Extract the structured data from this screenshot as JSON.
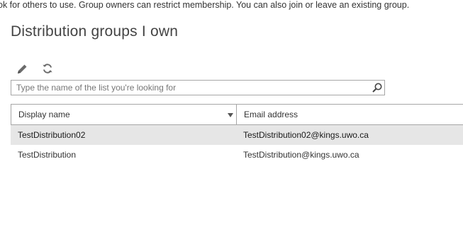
{
  "intro": {
    "text": "ok for others to use. Group owners can restrict membership. You can also join or leave an existing group."
  },
  "section": {
    "title": "Distribution groups I own"
  },
  "toolbar": {
    "edit_icon": "pencil-icon",
    "refresh_icon": "refresh-icon"
  },
  "search": {
    "placeholder": "Type the name of the list you're looking for",
    "value": "",
    "icon": "search-icon"
  },
  "table": {
    "columns": [
      {
        "label": "Display name",
        "sortable": true
      },
      {
        "label": "Email address"
      }
    ],
    "rows": [
      {
        "name": "TestDistribution02",
        "email": "TestDistribution02@kings.uwo.ca",
        "selected": true
      },
      {
        "name": "TestDistribution",
        "email": "TestDistribution@kings.uwo.ca",
        "selected": false
      }
    ]
  },
  "colors": {
    "selected_row": "#e6e6e6",
    "border": "#a6a6a6",
    "icon": "#666666"
  }
}
